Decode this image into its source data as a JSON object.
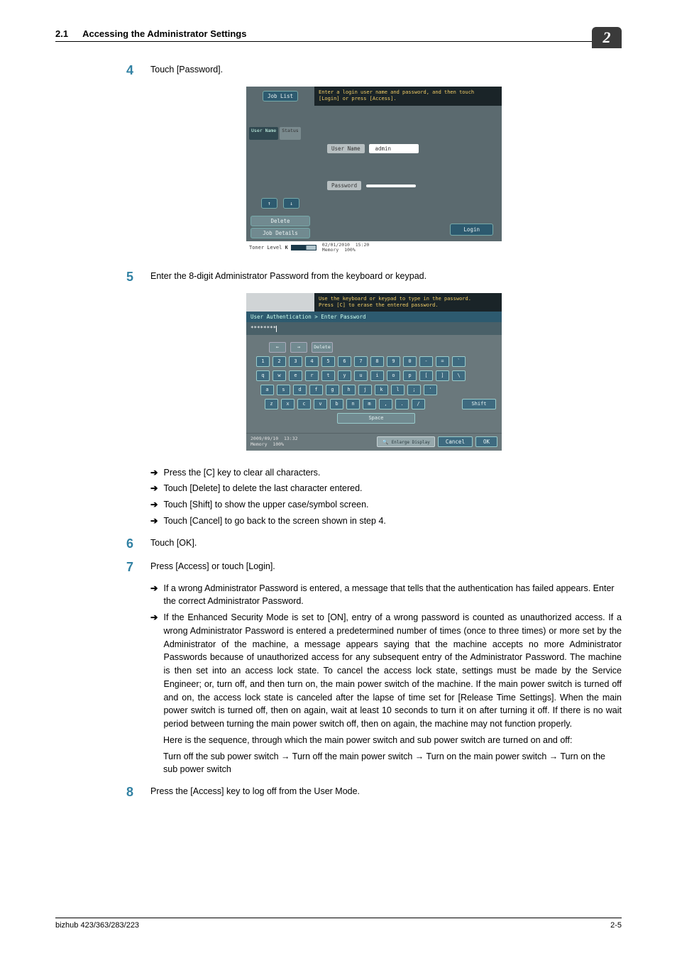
{
  "header": {
    "sec_num": "2.1",
    "sec_title": "Accessing the Administrator Settings",
    "chapter": "2"
  },
  "steps": {
    "s4": {
      "num": "4",
      "text": "Touch [Password]."
    },
    "s5": {
      "num": "5",
      "text": "Enter the 8-digit Administrator Password from the keyboard or keypad.",
      "subs": [
        "Press the [C] key to clear all characters.",
        "Touch [Delete] to delete the last character entered.",
        "Touch [Shift] to show the upper case/symbol screen.",
        "Touch [Cancel] to go back to the screen shown in step 4."
      ]
    },
    "s6": {
      "num": "6",
      "text": "Touch [OK]."
    },
    "s7": {
      "num": "7",
      "text": "Press [Access] or touch [Login].",
      "subs": [
        "If a wrong Administrator Password is entered, a message that tells that the authentication has failed appears. Enter the correct Administrator Password.",
        "If the Enhanced Security Mode is set to [ON], entry of a wrong password is counted as unauthorized access. If a wrong Administrator Password is entered a predetermined number of times (once to three times) or more set by the Administrator of the machine, a message appears saying that the machine accepts no more Administrator Passwords because of unauthorized access for any subsequent entry of the Administrator Password. The machine is then set into an access lock state. To cancel the access lock state, settings must be made by the Service Engineer; or, turn off, and then turn on, the main power switch of the machine. If the main power switch is turned off and on, the access lock state is canceled after the lapse of time set for [Release Time Settings]. When the main power switch is turned off, then on again, wait at least 10 seconds to turn it on after turning it off. If there is no wait period between turning the main power switch off, then on again, the machine may not function properly."
      ],
      "tail": [
        "Here is the sequence, through which the main power switch and sub power switch are turned on and off:",
        "Turn off the sub power switch → Turn off the main power switch → Turn on the main power switch → Turn on the sub power switch"
      ]
    },
    "s8": {
      "num": "8",
      "text": "Press the [Access] key to log off from the User Mode."
    }
  },
  "shot1": {
    "job_list": "Job List",
    "hint": "Enter a login user name and password, and then touch [Login] or press [Access].",
    "tab_user": "User Name",
    "tab_status": "Status",
    "field_user": "User Name",
    "val_user": "admin",
    "field_pass": "Password",
    "btn_up": "↑",
    "btn_down": "↓",
    "btn_delete": "Delete",
    "btn_details": "Job Details",
    "btn_login": "Login",
    "toner": "Toner Level",
    "toner_k": "K",
    "date": "02/01/2010",
    "time": "15:20",
    "mem_l": "Memory",
    "mem_v": "100%"
  },
  "shot2": {
    "hint1": "Use the keyboard or keypad to type in the password.",
    "hint2": "Press [C] to erase the entered password.",
    "breadcrumb": "User Authentication > Enter Password",
    "masked": "********",
    "nav_l": "←",
    "nav_r": "→",
    "nav_del": "Delete",
    "row1": [
      "1",
      "2",
      "3",
      "4",
      "5",
      "6",
      "7",
      "8",
      "9",
      "0",
      "-",
      "=",
      "`"
    ],
    "row2": [
      "q",
      "w",
      "e",
      "r",
      "t",
      "y",
      "u",
      "i",
      "o",
      "p",
      "[",
      "]",
      "\\"
    ],
    "row3": [
      "a",
      "s",
      "d",
      "f",
      "g",
      "h",
      "j",
      "k",
      "l",
      ";",
      "'"
    ],
    "row4": [
      "z",
      "x",
      "c",
      "v",
      "b",
      "n",
      "m",
      ",",
      ".",
      "/ "
    ],
    "shift": "Shift",
    "space": "Space",
    "date": "2009/09/10",
    "time": "13:32",
    "mem_l": "Memory",
    "mem_v": "100%",
    "enlarge": "Enlarge Display",
    "cancel": "Cancel",
    "ok": "OK"
  },
  "footer": {
    "model": "bizhub 423/363/283/223",
    "page": "2-5"
  }
}
